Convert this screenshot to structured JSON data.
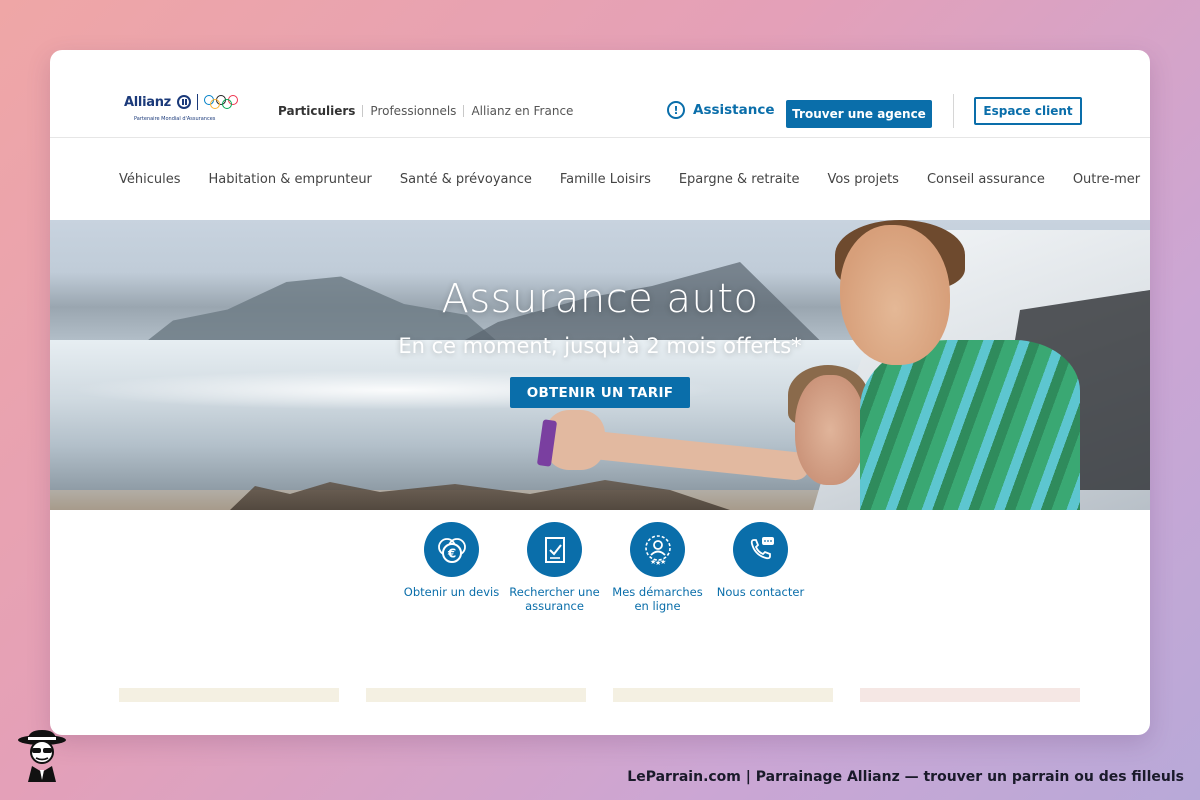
{
  "header": {
    "logo_text": "Allianz",
    "logo_tagline": "Partenaire Mondial d'Assurances",
    "segments": [
      {
        "label": "Particuliers",
        "active": true
      },
      {
        "label": "Professionnels",
        "active": false
      },
      {
        "label": "Allianz en France",
        "active": false
      }
    ],
    "assistance_label": "Assistance",
    "agency_button": "Trouver une agence",
    "client_button": "Espace client"
  },
  "nav": {
    "items": [
      "Véhicules",
      "Habitation & emprunteur",
      "Santé & prévoyance",
      "Famille Loisirs",
      "Epargne & retraite",
      "Vos projets",
      "Conseil assurance",
      "Outre-mer"
    ]
  },
  "hero": {
    "title": "Assurance auto",
    "subtitle": "En ce moment, jusqu'à 2 mois offerts*",
    "cta": "OBTENIR UN TARIF"
  },
  "actions": [
    {
      "label": "Obtenir un devis",
      "icon": "euro-coins-icon"
    },
    {
      "label": "Rechercher une assurance",
      "icon": "document-check-icon"
    },
    {
      "label": "Mes démarches en ligne",
      "icon": "user-stars-icon"
    },
    {
      "label": "Nous contacter",
      "icon": "phone-chat-icon"
    }
  ],
  "footer": {
    "caption": "LeParrain.com | Parrainage Allianz — trouver un parrain ou des filleuls"
  },
  "colors": {
    "brand_blue": "#0a6eaa",
    "logo_navy": "#1b3a7a"
  }
}
